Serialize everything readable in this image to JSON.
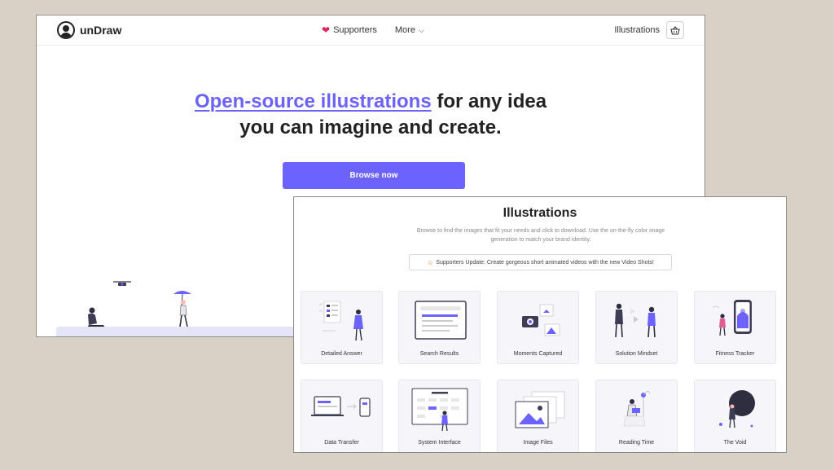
{
  "nav": {
    "logo_text": "unDraw",
    "supporters": "Supporters",
    "more": "More",
    "illustrations": "Illustrations"
  },
  "hero": {
    "headline_highlight": "Open-source illustrations",
    "headline_rest": " for any idea",
    "headline_line2": "you can imagine and create.",
    "cta": "Browse now"
  },
  "gallery": {
    "title": "Illustrations",
    "subtitle": "Browse to find the images that fit your needs and click to download. Use the on-the-fly color image generation to match your brand identity.",
    "update": "Supporters Update: Create gorgeous short animated videos with the new Video Shots!",
    "cards": [
      {
        "label": "Detailed Answer"
      },
      {
        "label": "Search Results"
      },
      {
        "label": "Moments Captured"
      },
      {
        "label": "Solution Mindset"
      },
      {
        "label": "Fitness Tracker"
      },
      {
        "label": "Data Transfer"
      },
      {
        "label": "System Interface"
      },
      {
        "label": "Image Files"
      },
      {
        "label": "Reading Time"
      },
      {
        "label": "The Void"
      }
    ]
  },
  "colors": {
    "accent": "#6c63ff",
    "background": "#d9d0c6",
    "heart": "#e0245e"
  }
}
